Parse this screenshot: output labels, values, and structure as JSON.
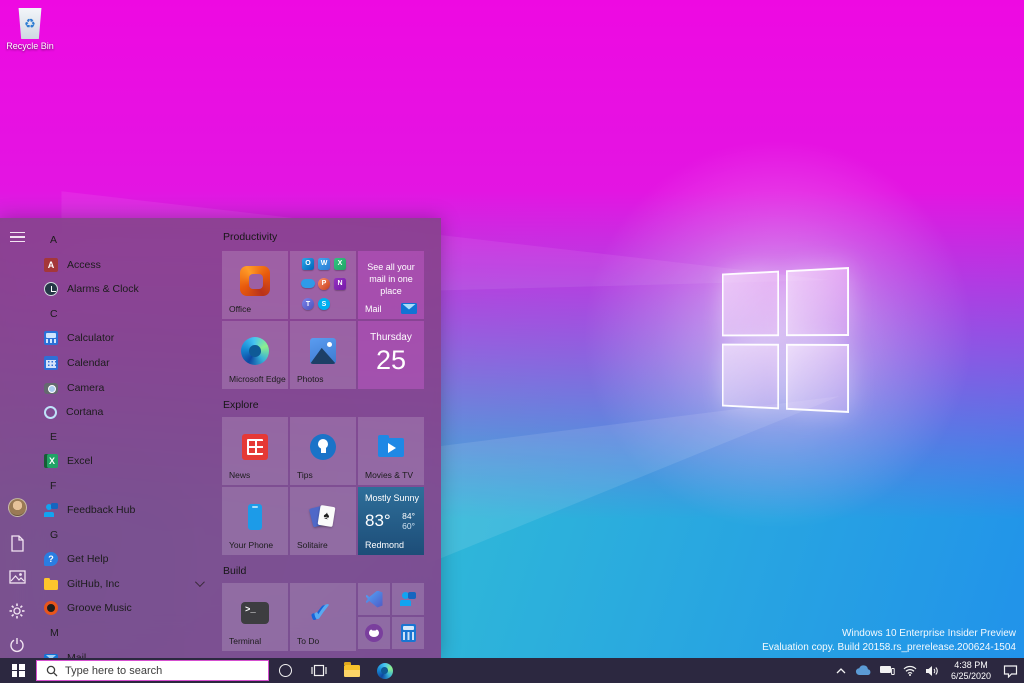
{
  "desktop": {
    "recycle_bin_label": "Recycle Bin",
    "watermark": {
      "line1": "Windows 10 Enterprise Insider Preview",
      "line2": "Evaluation copy. Build 20158.rs_prerelease.200624-1504"
    }
  },
  "start_menu": {
    "app_list": [
      {
        "type": "header",
        "label": "A"
      },
      {
        "type": "app",
        "label": "Access",
        "icon": "access-icon"
      },
      {
        "type": "app",
        "label": "Alarms & Clock",
        "icon": "alarm-clock-icon"
      },
      {
        "type": "header",
        "label": "C"
      },
      {
        "type": "app",
        "label": "Calculator",
        "icon": "calculator-icon"
      },
      {
        "type": "app",
        "label": "Calendar",
        "icon": "calendar-icon"
      },
      {
        "type": "app",
        "label": "Camera",
        "icon": "camera-icon"
      },
      {
        "type": "app",
        "label": "Cortana",
        "icon": "cortana-icon"
      },
      {
        "type": "header",
        "label": "E"
      },
      {
        "type": "app",
        "label": "Excel",
        "icon": "excel-icon"
      },
      {
        "type": "header",
        "label": "F"
      },
      {
        "type": "app",
        "label": "Feedback Hub",
        "icon": "feedback-hub-icon"
      },
      {
        "type": "header",
        "label": "G"
      },
      {
        "type": "app",
        "label": "Get Help",
        "icon": "get-help-icon"
      },
      {
        "type": "app",
        "label": "GitHub, Inc",
        "icon": "folder-icon",
        "expandable": true
      },
      {
        "type": "app",
        "label": "Groove Music",
        "icon": "groove-music-icon"
      },
      {
        "type": "header",
        "label": "M"
      },
      {
        "type": "app",
        "label": "Mail",
        "icon": "mail-icon"
      }
    ],
    "groups": [
      {
        "title": "Productivity"
      },
      {
        "title": "Explore"
      },
      {
        "title": "Build"
      }
    ],
    "tiles": {
      "office": "Office",
      "mail": {
        "message": "See all your mail in one place",
        "label": "Mail"
      },
      "edge": "Microsoft Edge",
      "photos": "Photos",
      "calendar": {
        "day": "Thursday",
        "date": "25"
      },
      "news": "News",
      "tips": "Tips",
      "movies": "Movies & TV",
      "your_phone": "Your Phone",
      "solitaire": "Solitaire",
      "weather": {
        "condition": "Mostly Sunny",
        "temp": "83°",
        "high": "84°",
        "low": "60°",
        "city": "Redmond"
      },
      "terminal": "Terminal",
      "todo": "To Do"
    }
  },
  "icons": {
    "access_letter": "A",
    "excel_letter": "X",
    "get_help_mark": "?",
    "outlook_letter": "O",
    "word_letter": "W",
    "excel_mini_letter": "X",
    "powerpoint_letter": "P",
    "onenote_letter": "N",
    "teams_letter": "T",
    "skype_letter": "S",
    "solitaire_spade": "♠",
    "terminal_prompt": ">_",
    "todo_check": "✓",
    "recycle_glyph": "♻"
  },
  "taskbar": {
    "search_placeholder": "Type here to search",
    "clock": {
      "time": "4:38 PM",
      "date": "6/25/2020"
    }
  },
  "colors": {
    "gradient_top": "#ee09e2",
    "gradient_bottom_left": "#1fe3a9",
    "gradient_bottom_right": "#2192ea",
    "start_menu_purple": "#85428b",
    "taskbar_dark": "#2c2840",
    "search_border_pink": "#d64fd0",
    "weather_tile_blue": "#2e6f9a"
  }
}
